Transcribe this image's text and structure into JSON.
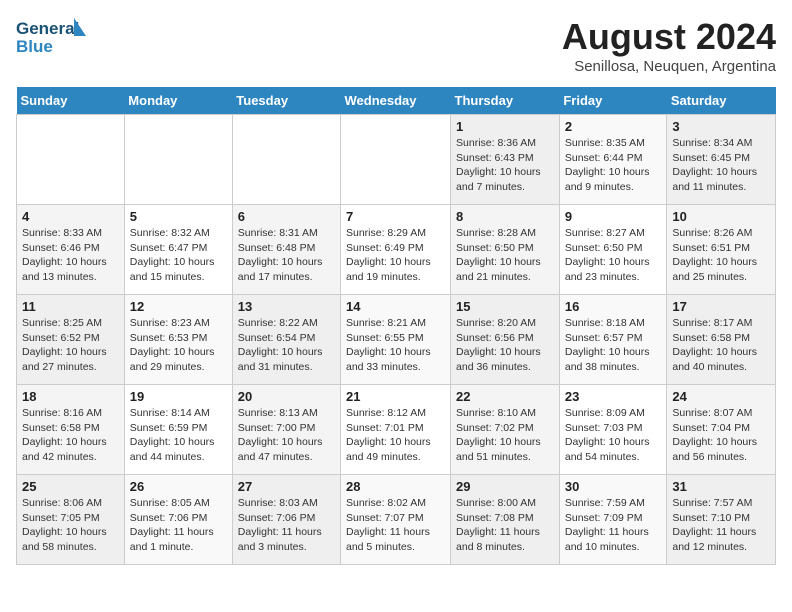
{
  "header": {
    "logo_line1": "General",
    "logo_line2": "Blue",
    "title": "August 2024",
    "subtitle": "Senillosa, Neuquen, Argentina"
  },
  "weekdays": [
    "Sunday",
    "Monday",
    "Tuesday",
    "Wednesday",
    "Thursday",
    "Friday",
    "Saturday"
  ],
  "weeks": [
    [
      {
        "day": "",
        "info": ""
      },
      {
        "day": "",
        "info": ""
      },
      {
        "day": "",
        "info": ""
      },
      {
        "day": "",
        "info": ""
      },
      {
        "day": "1",
        "info": "Sunrise: 8:36 AM\nSunset: 6:43 PM\nDaylight: 10 hours\nand 7 minutes."
      },
      {
        "day": "2",
        "info": "Sunrise: 8:35 AM\nSunset: 6:44 PM\nDaylight: 10 hours\nand 9 minutes."
      },
      {
        "day": "3",
        "info": "Sunrise: 8:34 AM\nSunset: 6:45 PM\nDaylight: 10 hours\nand 11 minutes."
      }
    ],
    [
      {
        "day": "4",
        "info": "Sunrise: 8:33 AM\nSunset: 6:46 PM\nDaylight: 10 hours\nand 13 minutes."
      },
      {
        "day": "5",
        "info": "Sunrise: 8:32 AM\nSunset: 6:47 PM\nDaylight: 10 hours\nand 15 minutes."
      },
      {
        "day": "6",
        "info": "Sunrise: 8:31 AM\nSunset: 6:48 PM\nDaylight: 10 hours\nand 17 minutes."
      },
      {
        "day": "7",
        "info": "Sunrise: 8:29 AM\nSunset: 6:49 PM\nDaylight: 10 hours\nand 19 minutes."
      },
      {
        "day": "8",
        "info": "Sunrise: 8:28 AM\nSunset: 6:50 PM\nDaylight: 10 hours\nand 21 minutes."
      },
      {
        "day": "9",
        "info": "Sunrise: 8:27 AM\nSunset: 6:50 PM\nDaylight: 10 hours\nand 23 minutes."
      },
      {
        "day": "10",
        "info": "Sunrise: 8:26 AM\nSunset: 6:51 PM\nDaylight: 10 hours\nand 25 minutes."
      }
    ],
    [
      {
        "day": "11",
        "info": "Sunrise: 8:25 AM\nSunset: 6:52 PM\nDaylight: 10 hours\nand 27 minutes."
      },
      {
        "day": "12",
        "info": "Sunrise: 8:23 AM\nSunset: 6:53 PM\nDaylight: 10 hours\nand 29 minutes."
      },
      {
        "day": "13",
        "info": "Sunrise: 8:22 AM\nSunset: 6:54 PM\nDaylight: 10 hours\nand 31 minutes."
      },
      {
        "day": "14",
        "info": "Sunrise: 8:21 AM\nSunset: 6:55 PM\nDaylight: 10 hours\nand 33 minutes."
      },
      {
        "day": "15",
        "info": "Sunrise: 8:20 AM\nSunset: 6:56 PM\nDaylight: 10 hours\nand 36 minutes."
      },
      {
        "day": "16",
        "info": "Sunrise: 8:18 AM\nSunset: 6:57 PM\nDaylight: 10 hours\nand 38 minutes."
      },
      {
        "day": "17",
        "info": "Sunrise: 8:17 AM\nSunset: 6:58 PM\nDaylight: 10 hours\nand 40 minutes."
      }
    ],
    [
      {
        "day": "18",
        "info": "Sunrise: 8:16 AM\nSunset: 6:58 PM\nDaylight: 10 hours\nand 42 minutes."
      },
      {
        "day": "19",
        "info": "Sunrise: 8:14 AM\nSunset: 6:59 PM\nDaylight: 10 hours\nand 44 minutes."
      },
      {
        "day": "20",
        "info": "Sunrise: 8:13 AM\nSunset: 7:00 PM\nDaylight: 10 hours\nand 47 minutes."
      },
      {
        "day": "21",
        "info": "Sunrise: 8:12 AM\nSunset: 7:01 PM\nDaylight: 10 hours\nand 49 minutes."
      },
      {
        "day": "22",
        "info": "Sunrise: 8:10 AM\nSunset: 7:02 PM\nDaylight: 10 hours\nand 51 minutes."
      },
      {
        "day": "23",
        "info": "Sunrise: 8:09 AM\nSunset: 7:03 PM\nDaylight: 10 hours\nand 54 minutes."
      },
      {
        "day": "24",
        "info": "Sunrise: 8:07 AM\nSunset: 7:04 PM\nDaylight: 10 hours\nand 56 minutes."
      }
    ],
    [
      {
        "day": "25",
        "info": "Sunrise: 8:06 AM\nSunset: 7:05 PM\nDaylight: 10 hours\nand 58 minutes."
      },
      {
        "day": "26",
        "info": "Sunrise: 8:05 AM\nSunset: 7:06 PM\nDaylight: 11 hours\nand 1 minute."
      },
      {
        "day": "27",
        "info": "Sunrise: 8:03 AM\nSunset: 7:06 PM\nDaylight: 11 hours\nand 3 minutes."
      },
      {
        "day": "28",
        "info": "Sunrise: 8:02 AM\nSunset: 7:07 PM\nDaylight: 11 hours\nand 5 minutes."
      },
      {
        "day": "29",
        "info": "Sunrise: 8:00 AM\nSunset: 7:08 PM\nDaylight: 11 hours\nand 8 minutes."
      },
      {
        "day": "30",
        "info": "Sunrise: 7:59 AM\nSunset: 7:09 PM\nDaylight: 11 hours\nand 10 minutes."
      },
      {
        "day": "31",
        "info": "Sunrise: 7:57 AM\nSunset: 7:10 PM\nDaylight: 11 hours\nand 12 minutes."
      }
    ]
  ]
}
